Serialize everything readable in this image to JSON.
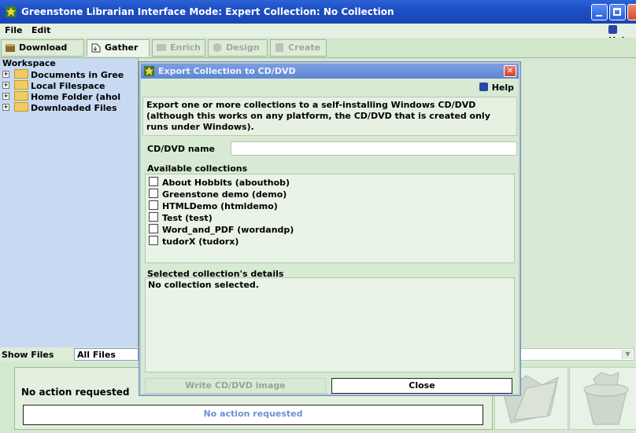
{
  "window": {
    "title": "Greenstone Librarian Interface  Mode: Expert  Collection: No Collection"
  },
  "menu": {
    "file": "File",
    "edit": "Edit",
    "help": "Help"
  },
  "tabs": [
    {
      "label": "Download",
      "state": "enabled"
    },
    {
      "label": "Gather",
      "state": "active"
    },
    {
      "label": "Enrich",
      "state": "disabled"
    },
    {
      "label": "Design",
      "state": "disabled"
    },
    {
      "label": "Create",
      "state": "disabled"
    }
  ],
  "workspace": {
    "title": "Workspace",
    "items": [
      "Documents in Gree",
      "Local Filespace",
      "Home Folder (ahol",
      "Downloaded Files"
    ]
  },
  "show_files": {
    "label": "Show Files",
    "value": "All Files"
  },
  "status": {
    "label": "No action requested",
    "progress_text": "No action requested"
  },
  "dialog": {
    "title": "Export Collection to CD/DVD",
    "help": "Help",
    "instructions": "Export one or more collections to a self-installing Windows CD/DVD (although this works on any platform, the CD/DVD that is created only runs under Windows).",
    "name_label": "CD/DVD name",
    "name_value": "",
    "available_label": "Available collections",
    "collections": [
      "About Hobbits (abouthob)",
      "Greenstone demo (demo)",
      "HTMLDemo (htmldemo)",
      "Test (test)",
      "Word_and_PDF (wordandp)",
      "tudorX (tudorx)"
    ],
    "details_label": "Selected collection's details",
    "details_text": "No collection selected.",
    "write_button": "Write CD/DVD image",
    "close_button": "Close"
  },
  "colors": {
    "titlebar": "#1d4fc4",
    "dialog_title": "#6b8fd8",
    "panel_green": "#d8ead3",
    "workspace_blue": "#c8daf2"
  }
}
